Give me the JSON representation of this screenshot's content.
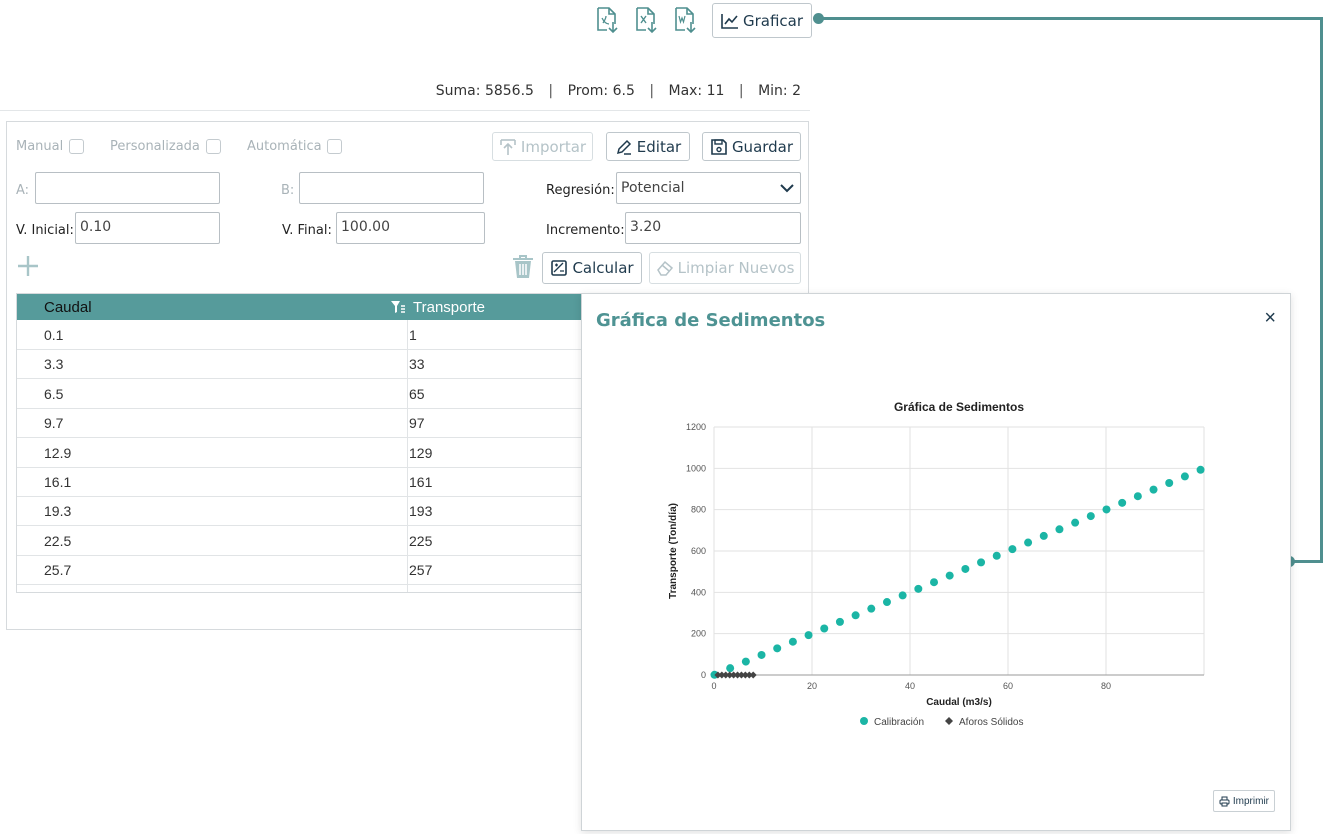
{
  "toolbar": {
    "export_icons": [
      "pdf-download-icon",
      "excel-download-icon",
      "word-download-icon"
    ],
    "graph_label": "Graficar"
  },
  "stats": {
    "sum_label": "Suma:",
    "sum_value": "5856.5",
    "avg_label": "Prom:",
    "avg_value": "6.5",
    "max_label": "Max:",
    "max_value": "11",
    "min_label": "Min:",
    "min_value": "2"
  },
  "options": {
    "manual": "Manual",
    "custom": "Personalizada",
    "auto": "Automática"
  },
  "buttons": {
    "import": "Importar",
    "edit": "Editar",
    "save": "Guardar",
    "calculate": "Calcular",
    "clear_new": "Limpiar Nuevos"
  },
  "form": {
    "a_label": "A:",
    "a_value": "",
    "b_label": "B:",
    "b_value": "",
    "regression_label": "Regresión:",
    "regression_value": "Potencial",
    "initial_label": "V. Inicial:",
    "initial_value": "0.10",
    "final_label": "V. Final:",
    "final_value": "100.00",
    "increment_label": "Incremento:",
    "increment_value": "3.20"
  },
  "table": {
    "headers": [
      "Caudal",
      "Transporte"
    ],
    "rows": [
      [
        "0.1",
        "1"
      ],
      [
        "3.3",
        "33"
      ],
      [
        "6.5",
        "65"
      ],
      [
        "9.7",
        "97"
      ],
      [
        "12.9",
        "129"
      ],
      [
        "16.1",
        "161"
      ],
      [
        "19.3",
        "193"
      ],
      [
        "22.5",
        "225"
      ],
      [
        "25.7",
        "257"
      ]
    ]
  },
  "modal": {
    "title": "Gráfica de Sedimentos",
    "close": "×",
    "print": "Imprimir"
  },
  "colors": {
    "accent": "#4f8f8f",
    "header": "#569b9b",
    "calibration": "#1bb5a5",
    "aforos": "#444444"
  },
  "chart_data": {
    "type": "scatter",
    "title": "Gráfica de Sedimentos",
    "xlabel": "Caudal (m3/s)",
    "ylabel": "Transporte (Ton/día)",
    "xlim": [
      0,
      100
    ],
    "ylim": [
      0,
      1200
    ],
    "xticks": [
      0,
      20,
      40,
      60,
      80
    ],
    "yticks": [
      0,
      200,
      400,
      600,
      800,
      1000,
      1200
    ],
    "grid": true,
    "legend_position": "bottom",
    "series": [
      {
        "name": "Calibración",
        "marker": "circle",
        "x": [
          0.1,
          3.3,
          6.5,
          9.7,
          12.9,
          16.1,
          19.3,
          22.5,
          25.7,
          28.9,
          32.1,
          35.3,
          38.5,
          41.7,
          44.9,
          48.1,
          51.3,
          54.5,
          57.7,
          60.9,
          64.1,
          67.3,
          70.5,
          73.7,
          76.9,
          80.1,
          83.3,
          86.5,
          89.7,
          92.9,
          96.1,
          99.3
        ],
        "y": [
          1,
          33,
          65,
          97,
          129,
          161,
          193,
          225,
          257,
          289,
          321,
          353,
          385,
          417,
          449,
          481,
          513,
          545,
          577,
          609,
          641,
          673,
          705,
          737,
          769,
          801,
          833,
          865,
          897,
          929,
          961,
          993
        ]
      },
      {
        "name": "Aforos Sólidos",
        "marker": "diamond",
        "x": [
          0.8,
          1.6,
          2.4,
          3.2,
          4.0,
          4.8,
          5.6,
          6.4,
          7.2,
          8.0
        ],
        "y": [
          0,
          0,
          0,
          0,
          0,
          0,
          0,
          0,
          0,
          0
        ]
      }
    ]
  }
}
